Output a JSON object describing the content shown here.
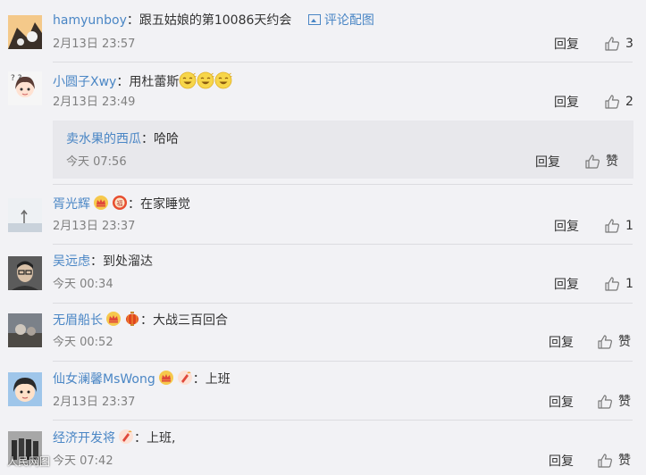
{
  "comments": [
    {
      "user": "hamyunboy",
      "sep": "：",
      "text": "跟五姑娘的第10086天约会",
      "pic_label": "评论配图",
      "time": "2月13日 23:57",
      "reply": "回复",
      "likes": "3"
    },
    {
      "user": "小圆子Xwy",
      "sep": "：",
      "text": "用杜蕾斯",
      "time": "2月13日 23:49",
      "reply": "回复",
      "likes": "2"
    },
    {
      "user": "胥光辉",
      "sep": "：",
      "text": "在家睡觉",
      "time": "2月13日 23:37",
      "reply": "回复",
      "likes": "1"
    },
    {
      "user": "吴远虑",
      "sep": "：",
      "text": "到处溜达",
      "time": "今天 00:34",
      "reply": "回复",
      "likes": "1"
    },
    {
      "user": "无眉船长",
      "sep": "：",
      "text": "大战三百回合",
      "time": "今天 00:52",
      "reply": "回复",
      "likes": "赞"
    },
    {
      "user": "仙女澜馨MsWong",
      "sep": "：",
      "text": "上班",
      "time": "2月13日 23:37",
      "reply": "回复",
      "likes": "赞"
    },
    {
      "user": "经济开发将",
      "sep": "：",
      "text": "上班,",
      "time": "今天 07:42",
      "reply": "回复",
      "likes": "赞"
    }
  ],
  "subreply": {
    "user": "卖水果的西瓜",
    "sep": "：",
    "text": "哈哈",
    "time": "今天 07:56",
    "reply": "回复",
    "likes": "赞"
  },
  "watermark": "人民网图",
  "colors": {
    "link": "#4a86c5",
    "background": "#f2f2f5",
    "subreply_bg": "#e8e8ec"
  }
}
